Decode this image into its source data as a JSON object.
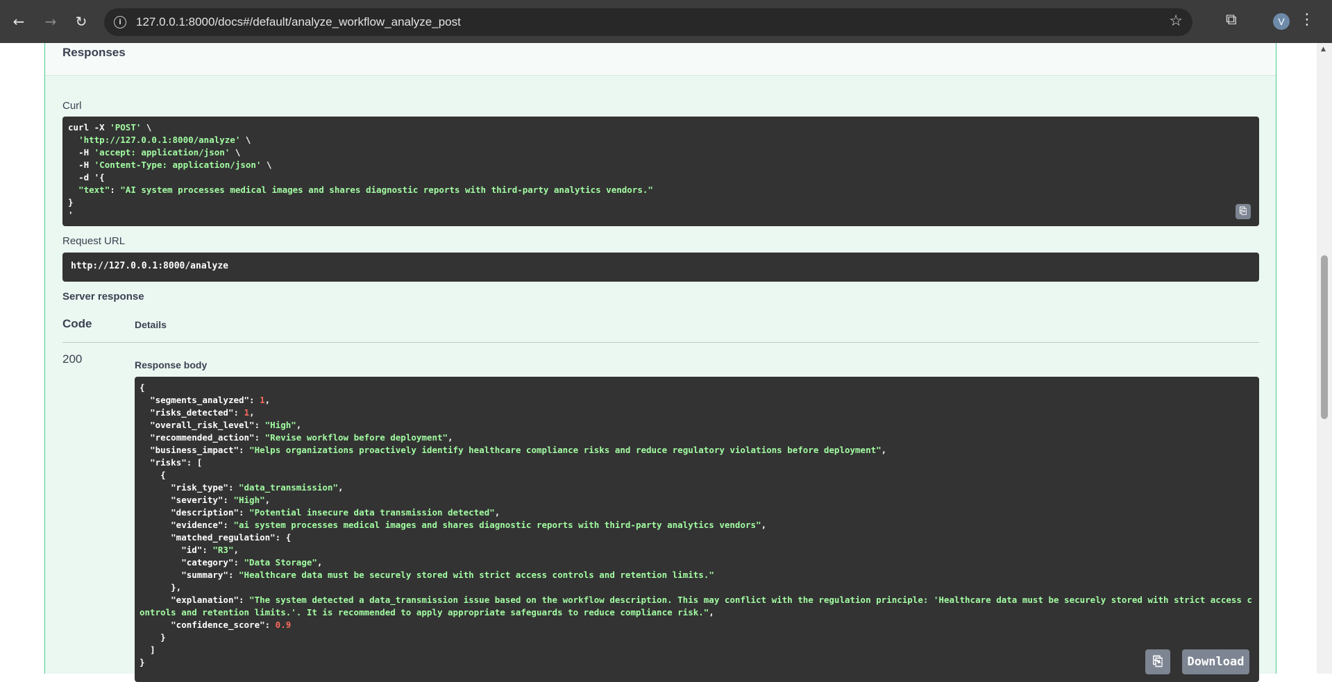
{
  "browser": {
    "url": "127.0.0.1:8000/docs#/default/analyze_workflow_analyze_post",
    "avatar_initial": "V",
    "icons": [
      "back-icon",
      "forward-icon",
      "reload-icon",
      "info-icon",
      "star-icon",
      "extensions-icon",
      "menu-icon"
    ]
  },
  "responses": {
    "title": "Responses",
    "curl_label": "Curl",
    "curl_lines": [
      "curl -X 'POST' \\",
      "  'http://127.0.0.1:8000/analyze' \\",
      "  -H 'accept: application/json' \\",
      "  -H 'Content-Type: application/json' \\",
      "  -d '{",
      "  \"text\": \"AI system processes medical images and shares diagnostic reports with third-party analytics vendors.\"",
      "}",
      "'"
    ],
    "request_url_label": "Request URL",
    "request_url": "http://127.0.0.1:8000/analyze",
    "server_response_label": "Server response",
    "code_header": "Code",
    "details_header": "Details",
    "status_code": "200",
    "response_body_label": "Response body",
    "download_label": "Download"
  },
  "response_body": {
    "segments_analyzed": 1,
    "risks_detected": 1,
    "overall_risk_level": "High",
    "recommended_action": "Revise workflow before deployment",
    "business_impact": "Helps organizations proactively identify healthcare compliance risks and reduce regulatory violations before deployment",
    "risk": {
      "risk_type": "data_transmission",
      "severity": "High",
      "description": "Potential insecure data transmission detected",
      "evidence": "ai system processes medical images and shares diagnostic reports with third-party analytics vendors",
      "matched_regulation": {
        "id": "R3",
        "category": "Data Storage",
        "summary": "Healthcare data must be securely stored with strict access controls and retention limits."
      },
      "explanation": "The system detected a data_transmission issue based on the workflow description. This may conflict with the regulation principle: 'Healthcare data must be securely stored with strict access controls and retention limits.'. It is recommended to apply appropriate safeguards to reduce compliance risk.",
      "confidence_score": 0.9
    }
  },
  "colors": {
    "post_green": "#49cc90",
    "code_bg": "#333333",
    "string": "#a2fca2",
    "number": "#fc6a5d"
  }
}
